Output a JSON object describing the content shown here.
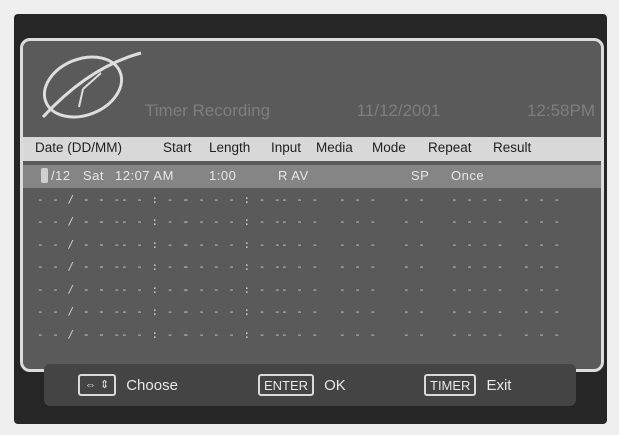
{
  "title": {
    "label": "Timer Recording",
    "date": "11/12/2001",
    "time": "12:58PM"
  },
  "columns": [
    "Date (DD/MM)",
    "Start",
    "Length",
    "Input",
    "Media",
    "Mode",
    "Repeat",
    "Result"
  ],
  "selected_entry": {
    "date": "/12",
    "day": "Sat",
    "start": "12:07 AM",
    "length": "1:00",
    "input": "R AV",
    "media": "",
    "mode": "SP",
    "repeat": "Once",
    "result": ""
  },
  "empty_entry": {
    "date": "- - / - -",
    "day": "- - -",
    "start": "- - : - -",
    "ampm": "- -",
    "length": "- - : - -",
    "input": "- - -",
    "media": "- - -",
    "mode": "- -",
    "repeat": "- - - -",
    "result": "- - -"
  },
  "footer": {
    "choose_label": "Choose",
    "enter_key": "ENTER",
    "ok_label": "OK",
    "timer_key": "TIMER",
    "exit_label": "Exit"
  }
}
